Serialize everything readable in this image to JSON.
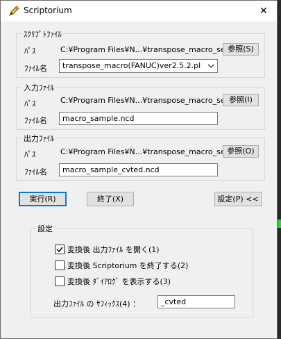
{
  "window": {
    "title": "Scriptorium",
    "close_glyph": "✕",
    "app_icon": "pen-icon"
  },
  "script_file": {
    "legend": "ｽｸﾘﾌﾟﾄﾌｧｲﾙ",
    "path_label": "ﾊﾟｽ",
    "path_value": "C:¥Program Files¥N...¥transpose_macro_set¥",
    "browse_label": "参照(S)",
    "filename_label": "ﾌｧｲﾙ名",
    "filename_value": "transpose_macro(FANUC)ver2.5.2.pl"
  },
  "input_file": {
    "legend": "入力ﾌｧｲﾙ",
    "path_label": "ﾊﾟｽ",
    "path_value": "C:¥Program Files¥N...¥transpose_macro_set¥",
    "browse_label": "参照(I)",
    "filename_label": "ﾌｧｲﾙ名",
    "filename_value": "macro_sample.ncd"
  },
  "output_file": {
    "legend": "出力ﾌｧｲﾙ",
    "path_label": "ﾊﾟｽ",
    "path_value": "C:¥Program Files¥N...¥transpose_macro_set¥",
    "browse_label": "参照(O)",
    "filename_label": "ﾌｧｲﾙ名",
    "filename_value": "macro_sample_cvted.ncd"
  },
  "actions": {
    "run_label": "実行(R)",
    "exit_label": "終了(X)",
    "settings_label": "設定(P) <<"
  },
  "settings": {
    "legend": "設定",
    "options": [
      {
        "label": "変換後 出力ﾌｧｲﾙ を開く(1)",
        "checked": true
      },
      {
        "label": "変換後 Scriptorium を終了する(2)",
        "checked": false
      },
      {
        "label": "変換後 ﾀﾞｲｱﾛｸﾞ を表示する(3)",
        "checked": false
      }
    ],
    "suffix_label": "出力ﾌｧｲﾙ の ｻﾌｨｯｸｽ(4) ：",
    "suffix_value": "_cvted"
  }
}
